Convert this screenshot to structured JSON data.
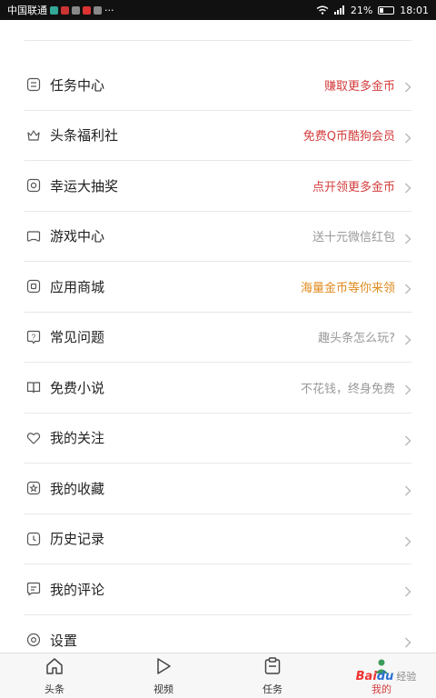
{
  "status_bar": {
    "carrier": "中国联通",
    "battery": "21%",
    "time": "18:01",
    "more": "···"
  },
  "menu": [
    {
      "icon": "task-list-icon",
      "label": "任务中心",
      "hint": "赚取更多金币",
      "hint_color": "red"
    },
    {
      "icon": "crown-icon",
      "label": "头条福利社",
      "hint": "免费Q币酷狗会员",
      "hint_color": "red"
    },
    {
      "icon": "lottery-icon",
      "label": "幸运大抽奖",
      "hint": "点开领更多金币",
      "hint_color": "red"
    },
    {
      "icon": "gamepad-icon",
      "label": "游戏中心",
      "hint": "送十元微信红包",
      "hint_color": "gray"
    },
    {
      "icon": "app-store-icon",
      "label": "应用商城",
      "hint": "海量金币等你来领",
      "hint_color": "orange"
    },
    {
      "icon": "question-icon",
      "label": "常见问题",
      "hint": "趣头条怎么玩?",
      "hint_color": "gray"
    },
    {
      "icon": "book-icon",
      "label": "免费小说",
      "hint": "不花钱，终身免费",
      "hint_color": "gray"
    },
    {
      "icon": "heart-icon",
      "label": "我的关注",
      "hint": "",
      "hint_color": "gray"
    },
    {
      "icon": "star-icon",
      "label": "我的收藏",
      "hint": "",
      "hint_color": "gray"
    },
    {
      "icon": "history-clock-icon",
      "label": "历史记录",
      "hint": "",
      "hint_color": "gray"
    },
    {
      "icon": "comment-icon",
      "label": "我的评论",
      "hint": "",
      "hint_color": "gray"
    },
    {
      "icon": "settings-icon",
      "label": "设置",
      "hint": "",
      "hint_color": "gray"
    }
  ],
  "tabbar": [
    {
      "icon": "home-icon",
      "label": "头条",
      "active": false
    },
    {
      "icon": "video-play-icon",
      "label": "视频",
      "active": false
    },
    {
      "icon": "task-clipboard-icon",
      "label": "任务",
      "active": false
    },
    {
      "icon": "profile-icon",
      "label": "我的",
      "active": true
    }
  ],
  "watermark": {
    "text_a": "Bai",
    "text_b": "du",
    "text_c": "经验"
  },
  "colors": {
    "red": "#d43d3d",
    "orange": "#e08a1e",
    "gray": "#999999",
    "divider": "#e7e7e7"
  }
}
